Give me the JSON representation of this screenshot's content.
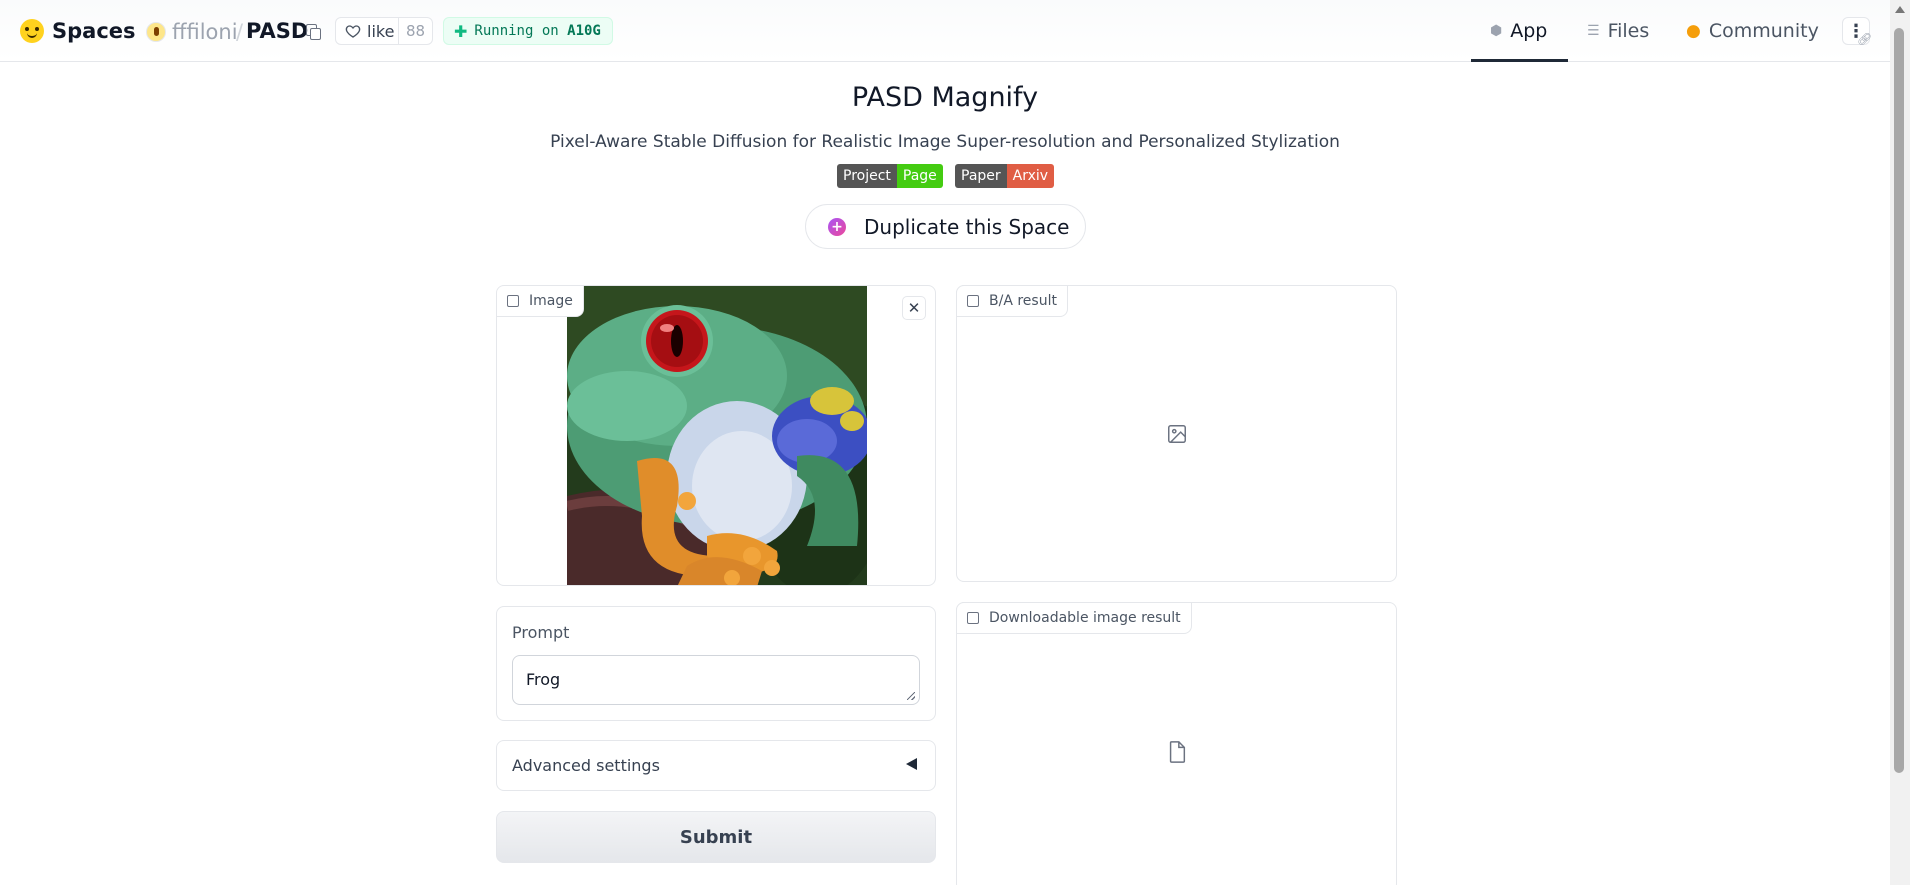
{
  "header": {
    "brand": "Spaces",
    "owner": "fffiloni",
    "separator": "/",
    "repo": "PASD",
    "like_label": "like",
    "like_count": "88",
    "status_prefix": "Running on",
    "status_hardware": "A10G",
    "tabs": [
      {
        "label": "App",
        "icon": "cube-icon",
        "active": true
      },
      {
        "label": "Files",
        "icon": "files-icon",
        "active": false
      },
      {
        "label": "Community",
        "icon": "community-icon",
        "active": false
      }
    ]
  },
  "main": {
    "title": "PASD Magnify",
    "subtitle": "Pixel-Aware Stable Diffusion for Realistic Image Super-resolution and Personalized Stylization",
    "badges": [
      {
        "left": "Project",
        "right": "Page",
        "right_color": "#44cc11"
      },
      {
        "left": "Paper",
        "right": "Arxiv",
        "right_color": "#e05d44"
      }
    ],
    "duplicate_label": "Duplicate this Space"
  },
  "form": {
    "image_label": "Image",
    "prompt_label": "Prompt",
    "prompt_value": "Frog",
    "advanced_label": "Advanced settings",
    "submit_label": "Submit"
  },
  "outputs": {
    "ba_label": "B/A result",
    "download_label": "Downloadable image result"
  },
  "colors": {
    "accent": "#1f2937",
    "running_bg": "#ecfdf5",
    "running_text": "#047857"
  }
}
